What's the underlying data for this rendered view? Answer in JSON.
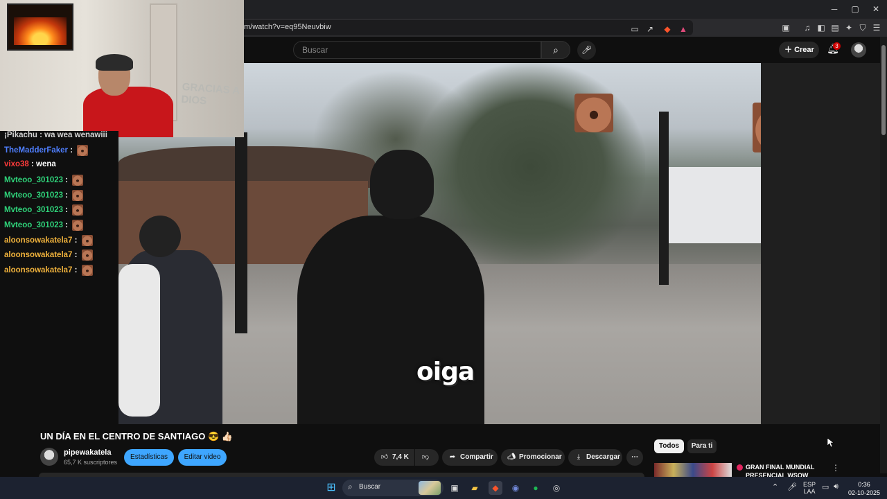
{
  "browser": {
    "url": "m/watch?v=eq95Neuvbiw",
    "window_controls": {
      "minimize": "─",
      "maximize": "▢",
      "close": "✕"
    }
  },
  "youtube_header": {
    "search_placeholder": "Buscar",
    "create_label": "Crear",
    "notification_count": "3"
  },
  "video": {
    "caption": "oiga"
  },
  "webcam": {
    "wall_text": "GRACIAS A DIOS"
  },
  "chat": {
    "partial_top": "¡Pikachu : wa wea wenawiii",
    "messages": [
      {
        "user": "TheMadderFaker",
        "color": "#4f7fff",
        "message": "",
        "emote": true
      },
      {
        "user": "vixo38",
        "color": "#ff3b3b",
        "message": "wena",
        "emote": false
      },
      {
        "user": "Mvteoo_301023",
        "color": "#2fd37a",
        "message": "",
        "emote": true
      },
      {
        "user": "Mvteoo_301023",
        "color": "#2fd37a",
        "message": "",
        "emote": true
      },
      {
        "user": "Mvteoo_301023",
        "color": "#2fd37a",
        "message": "",
        "emote": true
      },
      {
        "user": "Mvteoo_301023",
        "color": "#2fd37a",
        "message": "",
        "emote": true
      },
      {
        "user": "aloonsowakatela7",
        "color": "#f0b23c",
        "message": "",
        "emote": true
      },
      {
        "user": "aloonsowakatela7",
        "color": "#f0b23c",
        "message": "",
        "emote": true
      },
      {
        "user": "aloonsowakatela7",
        "color": "#f0b23c",
        "message": "",
        "emote": true
      }
    ]
  },
  "video_info": {
    "title": "UN DÍA EN EL CENTRO DE SANTIAGO 😎 👍🏻",
    "channel_name": "pipewakatela",
    "subscribers": "65,7 K suscriptores",
    "stats_button": "Estadísticas",
    "edit_button": "Editar video",
    "like_count": "7,4 K",
    "share_label": "Compartir",
    "promote_label": "Promocionar",
    "download_label": "Descargar"
  },
  "recommendations": {
    "chips": [
      "Todos",
      "Para ti"
    ],
    "first_title": "GRAN FINAL MUNDIAL PRESENCIAL WSOW"
  },
  "taskbar": {
    "search_text": "Buscar",
    "language": "ESP",
    "language_sub": "LAA",
    "time": "0:36",
    "date": "02-10-2025"
  },
  "colors": {
    "accent_blue": "#3ea6ff",
    "background": "#0f0f0f",
    "notification_red": "#cc0000"
  }
}
